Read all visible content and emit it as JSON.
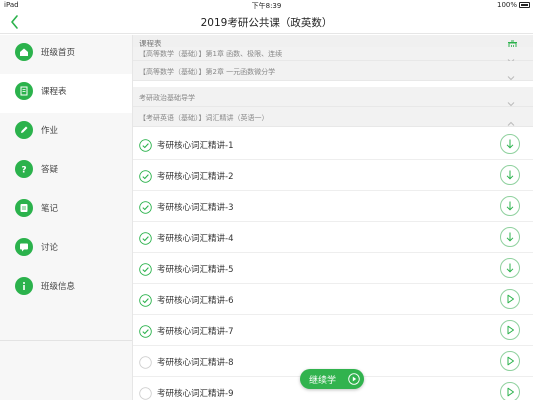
{
  "status_bar": {
    "device": "iPad",
    "time": "下午8:39",
    "battery": "100%"
  },
  "nav": {
    "title": "2019考研公共课（政英数）",
    "back_icon": "chevron-left-icon"
  },
  "sidebar": {
    "items": [
      {
        "label": "班级首页",
        "icon": "home-icon",
        "active": false
      },
      {
        "label": "课程表",
        "icon": "schedule-icon",
        "active": true
      },
      {
        "label": "作业",
        "icon": "pencil-icon",
        "active": false
      },
      {
        "label": "答疑",
        "icon": "question-icon",
        "active": false
      },
      {
        "label": "笔记",
        "icon": "notes-icon",
        "active": false
      },
      {
        "label": "讨论",
        "icon": "chat-icon",
        "active": false
      },
      {
        "label": "班级信息",
        "icon": "info-icon",
        "active": false
      }
    ]
  },
  "schedule": {
    "header": "课程表",
    "groups": [
      {
        "label": "【高等数学（基础）】第1章 函数、极限、连续",
        "expanded": false
      },
      {
        "label": "【高等数学（基础）】第2章 一元函数微分学",
        "expanded": false
      },
      {
        "label": "考研政治基础导学",
        "expanded": false
      },
      {
        "label": "【考研英语（基础）】词汇精讲（英语一）",
        "expanded": true
      }
    ],
    "lessons": [
      {
        "title": "考研核心词汇精讲-1",
        "checked": true,
        "action": "download"
      },
      {
        "title": "考研核心词汇精讲-2",
        "checked": true,
        "action": "download"
      },
      {
        "title": "考研核心词汇精讲-3",
        "checked": true,
        "action": "download"
      },
      {
        "title": "考研核心词汇精讲-4",
        "checked": true,
        "action": "download"
      },
      {
        "title": "考研核心词汇精讲-5",
        "checked": true,
        "action": "download"
      },
      {
        "title": "考研核心词汇精讲-6",
        "checked": true,
        "action": "play"
      },
      {
        "title": "考研核心词汇精讲-7",
        "checked": true,
        "action": "play"
      },
      {
        "title": "考研核心词汇精讲-8",
        "checked": false,
        "action": "play"
      },
      {
        "title": "考研核心词汇精讲-9",
        "checked": false,
        "action": "play"
      }
    ]
  },
  "continue_button": {
    "label": "继续学"
  },
  "colors": {
    "accent": "#2bb24c",
    "sidebar_bg": "#f7f7f7",
    "group_bg": "#f2f2f2"
  }
}
